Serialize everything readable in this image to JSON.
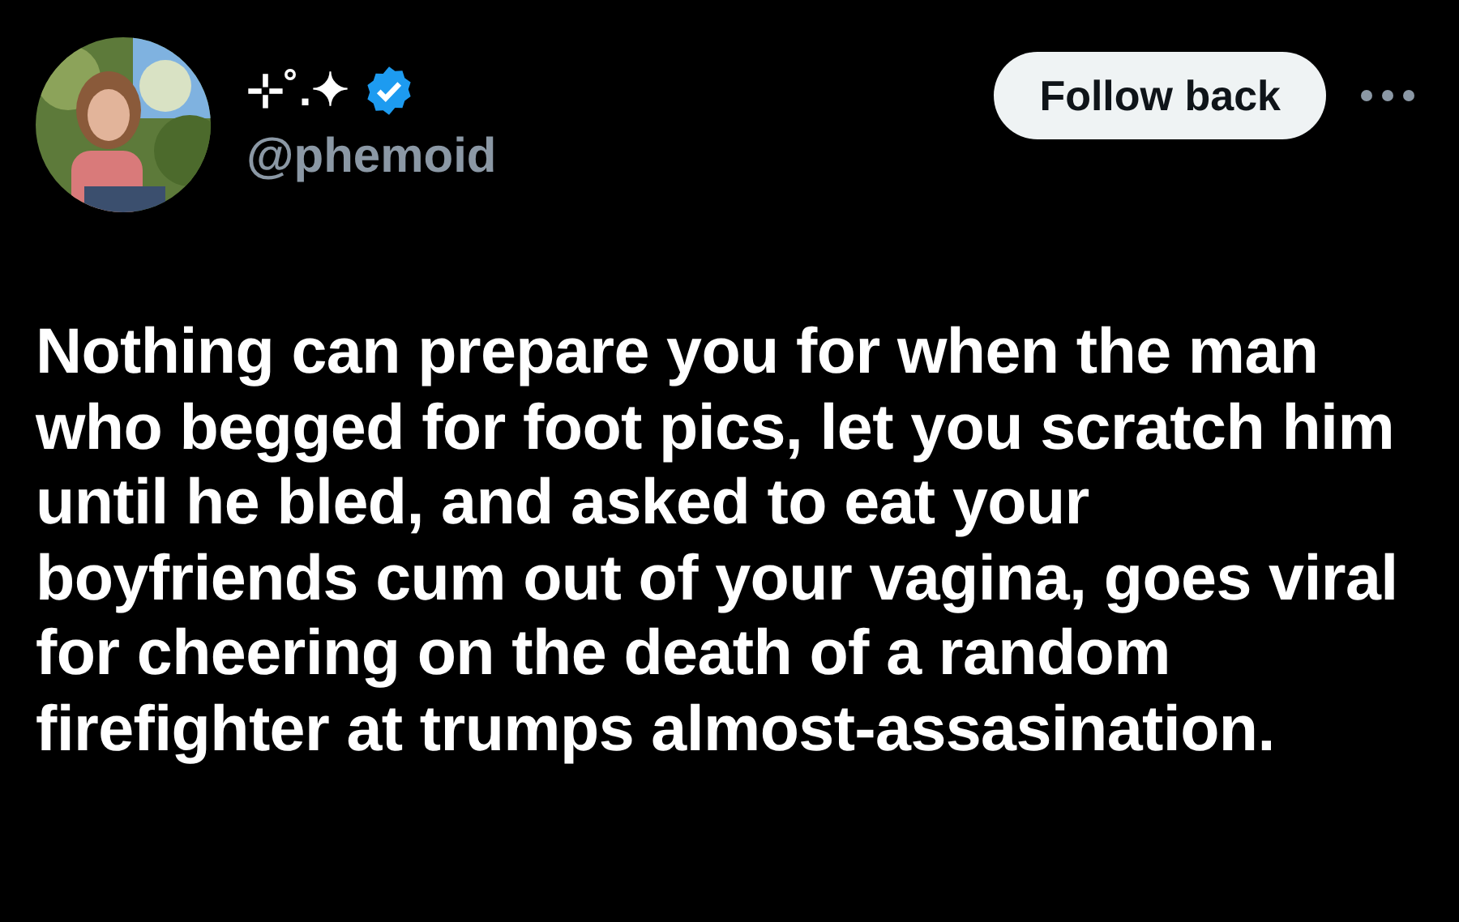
{
  "author": {
    "display_name": "⊹˚.✦",
    "verified": true,
    "handle": "@phemoid"
  },
  "follow_button": {
    "label": "Follow back"
  },
  "tweet": {
    "text": "Nothing can prepare you for when the man who begged for foot pics, let you scratch him until he bled, and asked to eat your boyfriends cum out of your vagina, goes viral for cheering on the death of a random firefighter at trumps almost-assasination."
  }
}
